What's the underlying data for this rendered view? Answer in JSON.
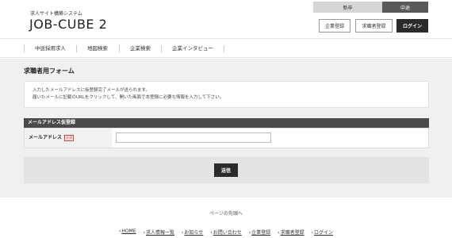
{
  "top_tabs": {
    "new_grad": "新卒",
    "mid_career": "中途"
  },
  "header": {
    "subtitle": "求人サイト構築システム",
    "logo": "JOB-CUBE 2",
    "company_register": "企業登録",
    "seeker_register": "求職者登録",
    "login": "ログイン"
  },
  "nav": {
    "items": [
      {
        "label": "中途採用求人"
      },
      {
        "label": "地図検索"
      },
      {
        "label": "企業検索"
      },
      {
        "label": "企業インタビュー"
      }
    ]
  },
  "form": {
    "title": "求職者用フォーム",
    "notice_line1": "入力したメールアドレスに仮登録完了メールが送られます。",
    "notice_line2": "届いたメールに記載のURLをクリックして、開いた画面で本登録に必要な情報を入力して下さい。",
    "section_title": "メールアドレス仮登録",
    "email_label": "メールアドレス",
    "required_badge": "必須",
    "email_value": "",
    "submit": "送信"
  },
  "page_top": "ページの先頭へ",
  "footer": {
    "links": [
      {
        "label": "HOME"
      },
      {
        "label": "求人情報一覧"
      },
      {
        "label": "お知らせ"
      },
      {
        "label": "お問い合わせ"
      },
      {
        "label": "企業登録"
      },
      {
        "label": "求職者登録"
      },
      {
        "label": "ログイン"
      }
    ]
  }
}
